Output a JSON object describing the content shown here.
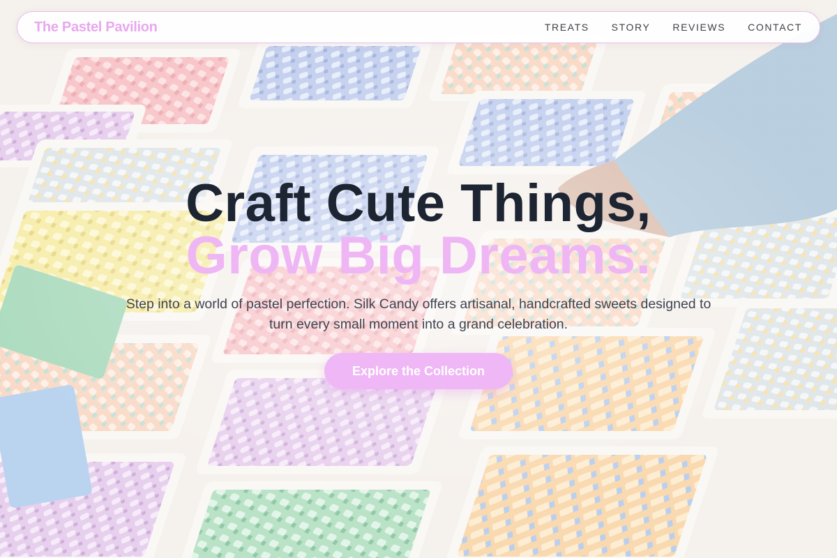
{
  "header": {
    "brand": "The Pastel Pavilion",
    "nav": [
      {
        "label": "TREATS"
      },
      {
        "label": "STORY"
      },
      {
        "label": "REVIEWS"
      },
      {
        "label": "CONTACT"
      }
    ]
  },
  "hero": {
    "headline_line1": "Craft Cute Things,",
    "headline_line2": "Grow Big Dreams.",
    "subtitle": "Step into a world of pastel perfection. Silk Candy offers artisanal, handcrafted sweets designed to turn every small moment into a grand celebration.",
    "cta_label": "Explore the Collection"
  },
  "colors": {
    "brand_pink": "#e7a8ee",
    "accent_pink": "#efb6f5",
    "headline_dark": "#1d2432",
    "body_text": "#3f4350"
  }
}
